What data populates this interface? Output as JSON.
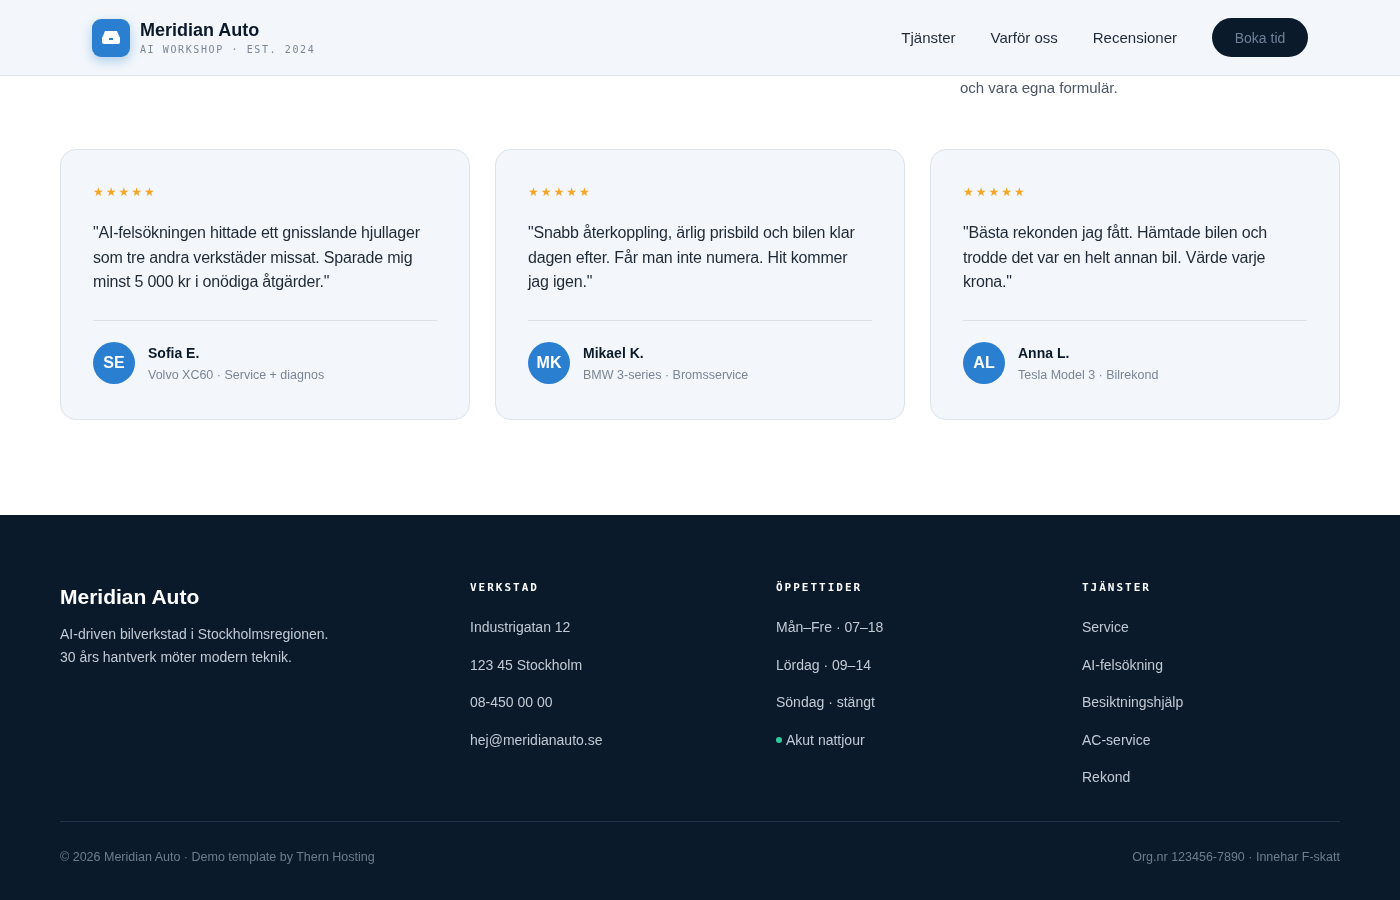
{
  "header": {
    "brand": "Meridian Auto",
    "tagline": "AI WORKSHOP · EST. 2024",
    "nav": [
      {
        "label": "Tjänster"
      },
      {
        "label": "Varför oss"
      },
      {
        "label": "Recensioner"
      }
    ],
    "cta": "Boka tid"
  },
  "section": {
    "intro": "och vara egna formulär."
  },
  "reviews": [
    {
      "stars": 5,
      "quote": "\"AI-felsökningen hittade ett gnisslande hjullager som tre andra verkstäder missat. Sparade mig minst 5 000 kr i onödiga åtgärder.\"",
      "initials": "SE",
      "name": "Sofia E.",
      "detail": "Volvo XC60 · Service + diagnos"
    },
    {
      "stars": 5,
      "quote": "\"Snabb återkoppling, ärlig prisbild och bilen klar dagen efter. Får man inte numera. Hit kommer jag igen.\"",
      "initials": "MK",
      "name": "Mikael K.",
      "detail": "BMW 3-series · Bromsservice"
    },
    {
      "stars": 5,
      "quote": "\"Bästa rekonden jag fått. Hämtade bilen och trodde det var en helt annan bil. Värde varje krona.\"",
      "initials": "AL",
      "name": "Anna L.",
      "detail": "Tesla Model 3 · Bilrekond"
    }
  ],
  "footer": {
    "brand": "Meridian Auto",
    "about": [
      "AI-driven bilverkstad i Stockholmsregionen.",
      "30 års hantverk möter modern teknik."
    ],
    "columns": [
      {
        "title": "VERKSTAD",
        "items": [
          {
            "text": "Industrigatan 12",
            "dot": false
          },
          {
            "text": "123 45 Stockholm",
            "dot": false
          },
          {
            "text": "08-450 00 00",
            "dot": false
          },
          {
            "text": "hej@meridianauto.se",
            "dot": false
          }
        ]
      },
      {
        "title": "ÖPPETTIDER",
        "items": [
          {
            "text": "Mån–Fre · 07–18",
            "dot": false
          },
          {
            "text": "Lördag · 09–14",
            "dot": false
          },
          {
            "text": "Söndag · stängt",
            "dot": false
          },
          {
            "text": "Akut nattjour",
            "dot": true
          }
        ]
      },
      {
        "title": "TJÄNSTER",
        "items": [
          {
            "text": "Service",
            "dot": false
          },
          {
            "text": "AI-felsökning",
            "dot": false
          },
          {
            "text": "Besiktningshjälp",
            "dot": false
          },
          {
            "text": "AC-service",
            "dot": false
          },
          {
            "text": "Rekond",
            "dot": false
          }
        ]
      }
    ],
    "copyright": "© 2026 Meridian Auto · Demo template by Thern Hosting",
    "org": "Org.nr 123456-7890 · Innehar F-skatt"
  }
}
